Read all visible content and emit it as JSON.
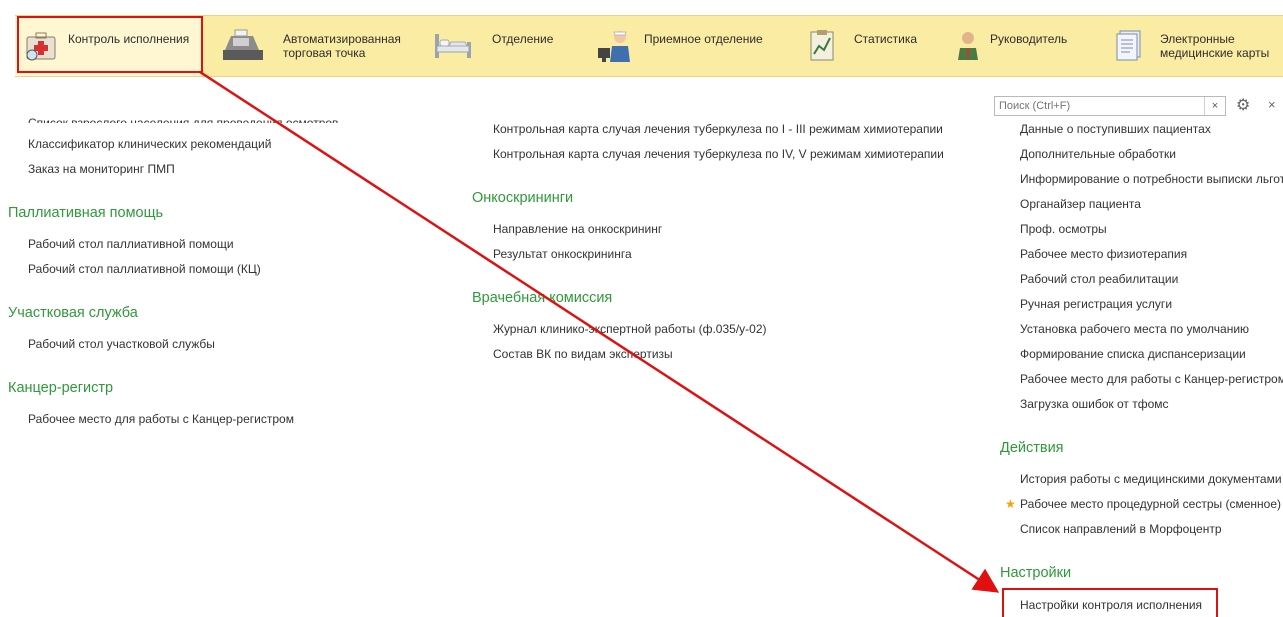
{
  "sections": [
    {
      "label": "Контроль исполнения",
      "icon": "medical-kit-icon"
    },
    {
      "label": "Автоматизированная\nторговая точка",
      "icon": "cash-register-icon"
    },
    {
      "label": "Отделение",
      "icon": "hospital-bed-icon"
    },
    {
      "label": "Приемное отделение",
      "icon": "nurse-icon"
    },
    {
      "label": "Статистика",
      "icon": "clipboard-chart-icon"
    },
    {
      "label": "Руководитель",
      "icon": "manager-icon"
    },
    {
      "label": "Электронные\nмедицинские карты",
      "icon": "records-icon"
    }
  ],
  "left": {
    "cut_item": "Список взрослого населения для проведения осмотров",
    "items_top": [
      "Классификатор клинических рекомендаций",
      "Заказ на мониторинг ПМП"
    ],
    "groups": [
      {
        "title": "Паллиативная помощь",
        "items": [
          "Рабочий стол паллиативной помощи",
          "Рабочий стол паллиативной помощи (КЦ)"
        ]
      },
      {
        "title": "Участковая служба",
        "items": [
          "Рабочий стол участковой службы"
        ]
      },
      {
        "title": "Канцер-регистр",
        "items": [
          "Рабочее место для работы с Канцер-регистром"
        ]
      }
    ]
  },
  "middle": {
    "items_top": [
      "Контрольная карта случая лечения туберкулеза по I - III режимам химиотерапии",
      "Контрольная карта случая лечения туберкулеза по IV, V режимам химиотерапии"
    ],
    "groups": [
      {
        "title": "Онкоскрининги",
        "items": [
          "Направление на онкоскрининг",
          "Результат онкоскрининга"
        ]
      },
      {
        "title": "Врачебная комиссия",
        "items": [
          "Журнал клинико-экспертной работы (ф.035/у-02)",
          "Состав ВК по видам экспертизы"
        ]
      }
    ]
  },
  "right": {
    "search_placeholder": "Поиск (Ctrl+F)",
    "search_clear": "×",
    "close_label": "×",
    "items_top": [
      "Данные о поступивших пациентах",
      "Дополнительные обработки",
      "Информирование о потребности выписки льготных",
      "Органайзер пациента",
      "Проф. осмотры",
      "Рабочее место физиотерапия",
      "Рабочий стол реабилитации",
      "Ручная регистрация услуги",
      "Установка рабочего места по умолчанию",
      "Формирование списка диспансеризации",
      "Рабочее место для работы с Канцер-регистром",
      "Загрузка ошибок от тфомс"
    ],
    "actions_title": "Действия",
    "actions": [
      "История работы с медицинскими документами",
      "Рабочее место процедурной сестры (сменное)",
      "Список направлений в Морфоцентр"
    ],
    "settings_title": "Настройки",
    "settings": [
      "Настройки контроля исполнения"
    ]
  },
  "colors": {
    "accent_green": "#2f9a3a",
    "highlight_red": "#e01010",
    "panel_yellow": "#fbeca4"
  }
}
